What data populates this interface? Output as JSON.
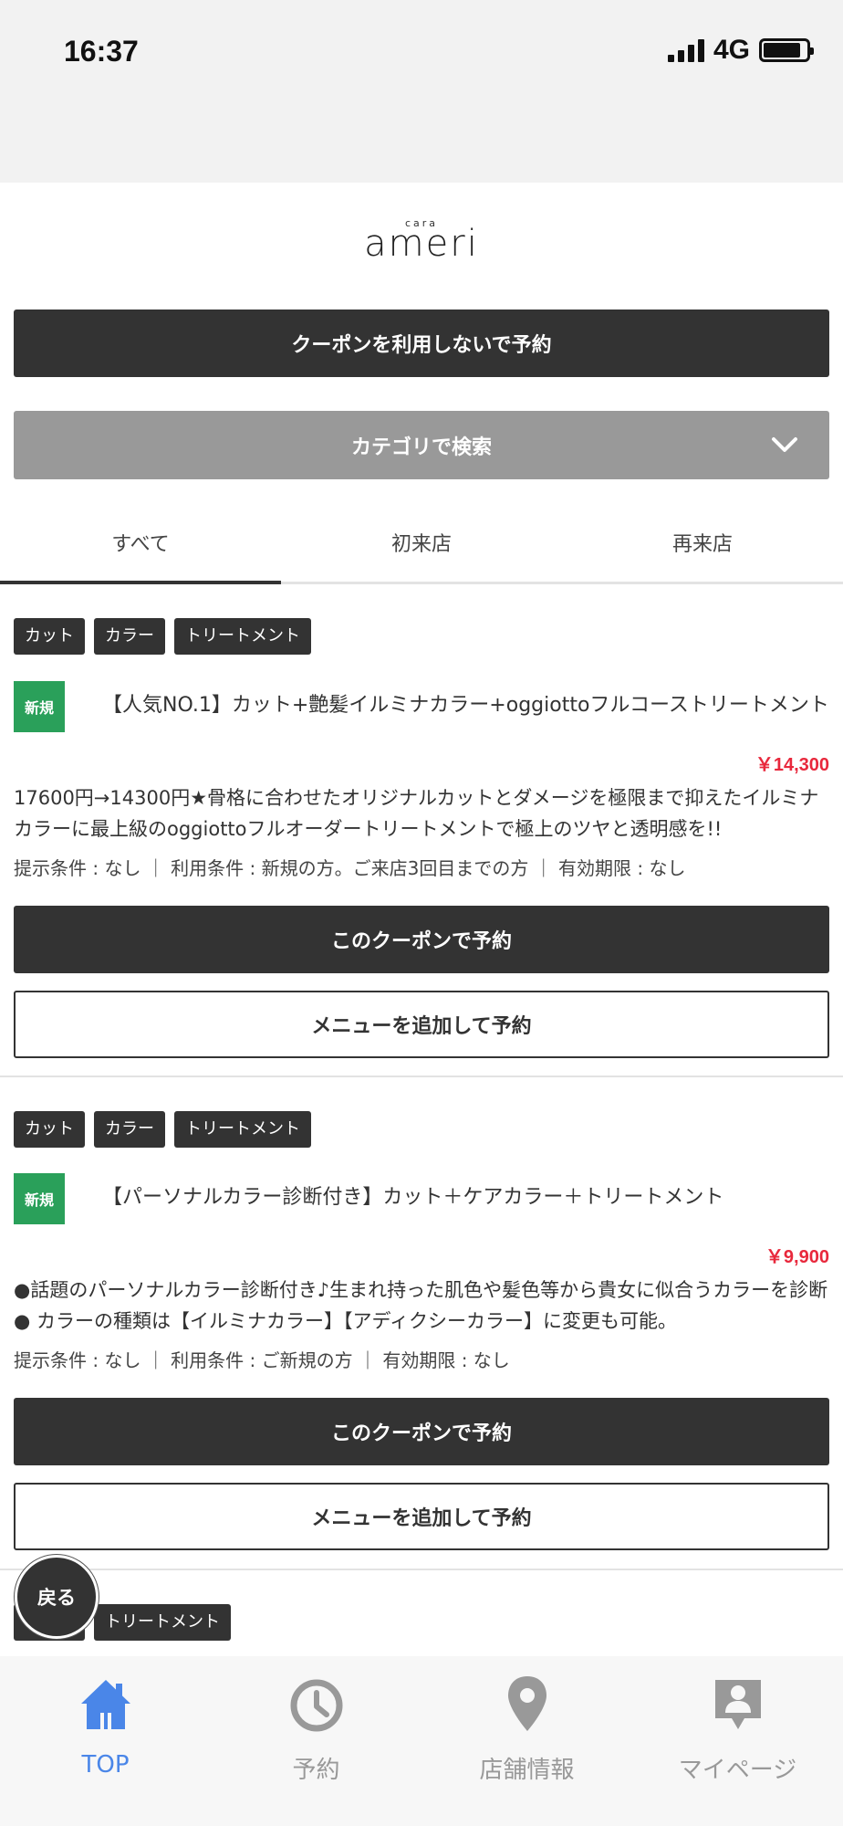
{
  "status": {
    "time": "16:37",
    "network": "4G"
  },
  "logo": {
    "small": "cara",
    "main": "ameri"
  },
  "top_actions": {
    "reserve_without_coupon": "クーポンを利用しないで予約",
    "category_search": "カテゴリで検索"
  },
  "tabs": [
    {
      "label": "すべて",
      "active": true
    },
    {
      "label": "初来店",
      "active": false
    },
    {
      "label": "再来店",
      "active": false
    }
  ],
  "coupons": [
    {
      "tags": [
        "カット",
        "カラー",
        "トリートメント"
      ],
      "badge": "新規",
      "title": "【人気NO.1】カット+艶髪イルミナカラー+oggiottoフルコーストリートメント",
      "price": "￥14,300",
      "description": "17600円→14300円★骨格に合わせたオリジナルカットとダメージを極限まで抑えたイルミナカラーに最上級のoggiottoフルオーダートリートメントで極上のツヤと透明感を!!",
      "conditions": "提示条件 : なし ｜ 利用条件 : 新規の方。ご来店3回目までの方 ｜ 有効期限 : なし",
      "reserve_label": "このクーポンで予約",
      "add_menu_label": "メニューを追加して予約"
    },
    {
      "tags": [
        "カット",
        "カラー",
        "トリートメント"
      ],
      "badge": "新規",
      "title": "【パーソナルカラー診断付き】カット＋ケアカラー＋トリートメント",
      "price": "￥9,900",
      "description": "●話題のパーソナルカラー診断付き♪生まれ持った肌色や髪色等から貴女に似合うカラーを診断● カラーの種類は【イルミナカラー】【アディクシーカラー】に変更も可能。",
      "conditions": "提示条件 : なし ｜ 利用条件 : ご新規の方 ｜ 有効期限 : なし",
      "reserve_label": "このクーポンで予約",
      "add_menu_label": "メニューを追加して予約"
    },
    {
      "tags": [
        "カット",
        "トリートメント"
      ]
    }
  ],
  "back_button": "戻る",
  "bottom_nav": [
    {
      "label": "TOP",
      "icon": "home-icon",
      "active": true
    },
    {
      "label": "予約",
      "icon": "clock-icon",
      "active": false
    },
    {
      "label": "店舗情報",
      "icon": "location-pin-icon",
      "active": false
    },
    {
      "label": "マイページ",
      "icon": "user-card-icon",
      "active": false
    }
  ],
  "colors": {
    "dark": "#333333",
    "accent_blue": "#4a86e8",
    "price_red": "#e8283c",
    "badge_green": "#2aa05a",
    "gray_button": "#999999"
  }
}
